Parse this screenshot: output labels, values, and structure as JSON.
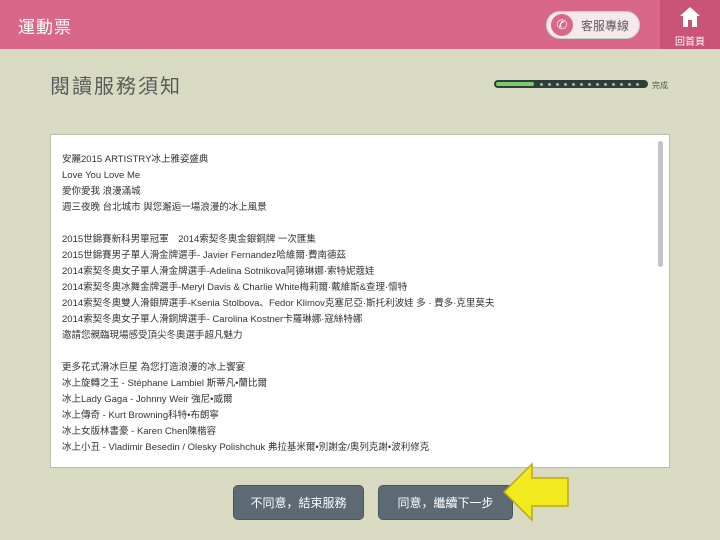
{
  "header": {
    "brand": "運動票",
    "service_label": "客服專線",
    "service_icon": "phone-icon",
    "home_label": "回首頁",
    "home_icon": "home-icon",
    "bg_color": "#d9678a"
  },
  "page": {
    "title": "閱讀服務須知",
    "progress_label": "完成",
    "progress_fraction": 0.25
  },
  "notice": {
    "lines": [
      "安麗2015 ARTISTRY冰上雅姿盛典",
      "Love You Love Me",
      "愛你愛我 浪漫滿城",
      "週三夜晚 台北城市 與您邂逅一場浪漫的冰上風景",
      "",
      "2015世錦賽新科男單冠軍　2014索契冬奧金銀銅牌 一次匯集",
      "2015世錦賽男子單人滑金牌選手- Javier Fernandez哈維爾·費南德茲",
      "2014索契冬奧女子單人滑金牌選手-Adelina Sotnikova阿德琳娜·索特妮蔻娃",
      "2014索契冬奧冰舞金牌選手-Meryl Davis & Charlie White梅莉爾·戴維斯&查理·懷特",
      "2014索契冬奧雙人滑銀牌選手-Ksenia Stolbova、Fedor Klimov克塞尼亞·斯托利波娃 多 · 費多·克里莫夫",
      "2014索契冬奧女子單人滑銅牌選手- Carolina Kostner卡羅琳娜·寇絲特娜",
      "邀請您親臨現場感受頂尖冬奧選手超凡魅力",
      "",
      "更多花式滑冰巨星 為您打造浪漫的冰上饗宴",
      "冰上旋轉之王 - Stéphane Lambiel 斯蒂凡•蘭比爾",
      "冰上Lady Gaga - Johnny Weir 強尼•威爾",
      "冰上傳奇 - Kurt Browning科特•布朗寧",
      "冰上女版林書豪 - Karen Chen陳楷容",
      "冰上小丑 - Vladimir Besedin / Olesky Polishchuk 弗拉基米爾•別謝金/奧列克謝•波利修克"
    ]
  },
  "buttons": {
    "decline": "不同意，結束服務",
    "agree": "同意，繼續下一步"
  },
  "annotation": {
    "arrow_icon": "arrow-left-icon",
    "arrow_color": "#f2ea1e"
  }
}
